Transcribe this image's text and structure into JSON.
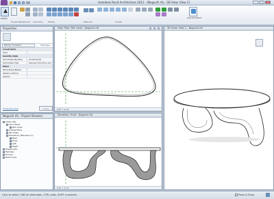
{
  "app": {
    "title": "Autodesk Revit Architecture 2011 - [Noguchi.rfa - 3D View: View 1]"
  },
  "ribbon": {
    "modify_label": "Modify",
    "load_label": "Load into Project",
    "group_labels": [
      "Select",
      "Properties",
      "Clipboard",
      "Geometry",
      "Modify",
      "Measure",
      "Create",
      "Family Editor"
    ]
  },
  "properties": {
    "title": "Properties",
    "type_label": "Family: Furniture",
    "edit_type": "Edit Type",
    "sections": [
      {
        "label": "Constraints",
        "group": true
      },
      {
        "label": "Host",
        "value": "",
        "group": false
      },
      {
        "label": "Identity Data",
        "group": true
      },
      {
        "label": "OmniClass Number",
        "value": "23.40.20.00",
        "group": false
      },
      {
        "label": "OmniClass Title",
        "value": "General Furniture and Spe",
        "group": false
      },
      {
        "label": "Other",
        "group": true
      },
      {
        "label": "Work Plane-Based",
        "value": "",
        "group": false
      },
      {
        "label": "Always vertical",
        "value": "",
        "group": false
      },
      {
        "label": "Shared",
        "value": "",
        "group": false
      }
    ],
    "help_link": "Properties help",
    "apply": "Apply"
  },
  "browser": {
    "title": "Noguchi.rfa - Project Browser",
    "items": [
      {
        "label": "Views (all)",
        "level": 0
      },
      {
        "label": "Floor Plans",
        "level": 1
      },
      {
        "label": "Ref. Level",
        "level": 2
      },
      {
        "label": "Ceiling Plans",
        "level": 1
      },
      {
        "label": "3D Views",
        "level": 1
      },
      {
        "label": "Elevations (Elevation 1)",
        "level": 1
      },
      {
        "label": "Back",
        "level": 2
      },
      {
        "label": "Front",
        "level": 2
      },
      {
        "label": "Left",
        "level": 2
      },
      {
        "label": "Right",
        "level": 2
      },
      {
        "label": "Sheets (all)",
        "level": 0
      },
      {
        "label": "Families",
        "level": 0
      },
      {
        "label": "Groups",
        "level": 0
      },
      {
        "label": "Revit Links",
        "level": 0
      }
    ]
  },
  "views": {
    "plan_title": "Floor Plan: Ref. Level - Noguchi.rfa",
    "elevation_title": "Elevation: Front - Noguchi.rfa",
    "threed_title": "3D View: View 1 - Noguchi.rfa",
    "plan_scale": "1/4\" = 1'-0\"",
    "elevation_scale": "1/4\" = 1'-0\""
  },
  "status": {
    "text": "Click to select, TAB for alternates, CTRL adds, SHIFT unselects.",
    "press": "Press & Drag"
  },
  "colors": {
    "accent": "#3a6ea5",
    "ref_plane": "#2e9e3b",
    "cut_fill": "#9a9a9a"
  }
}
